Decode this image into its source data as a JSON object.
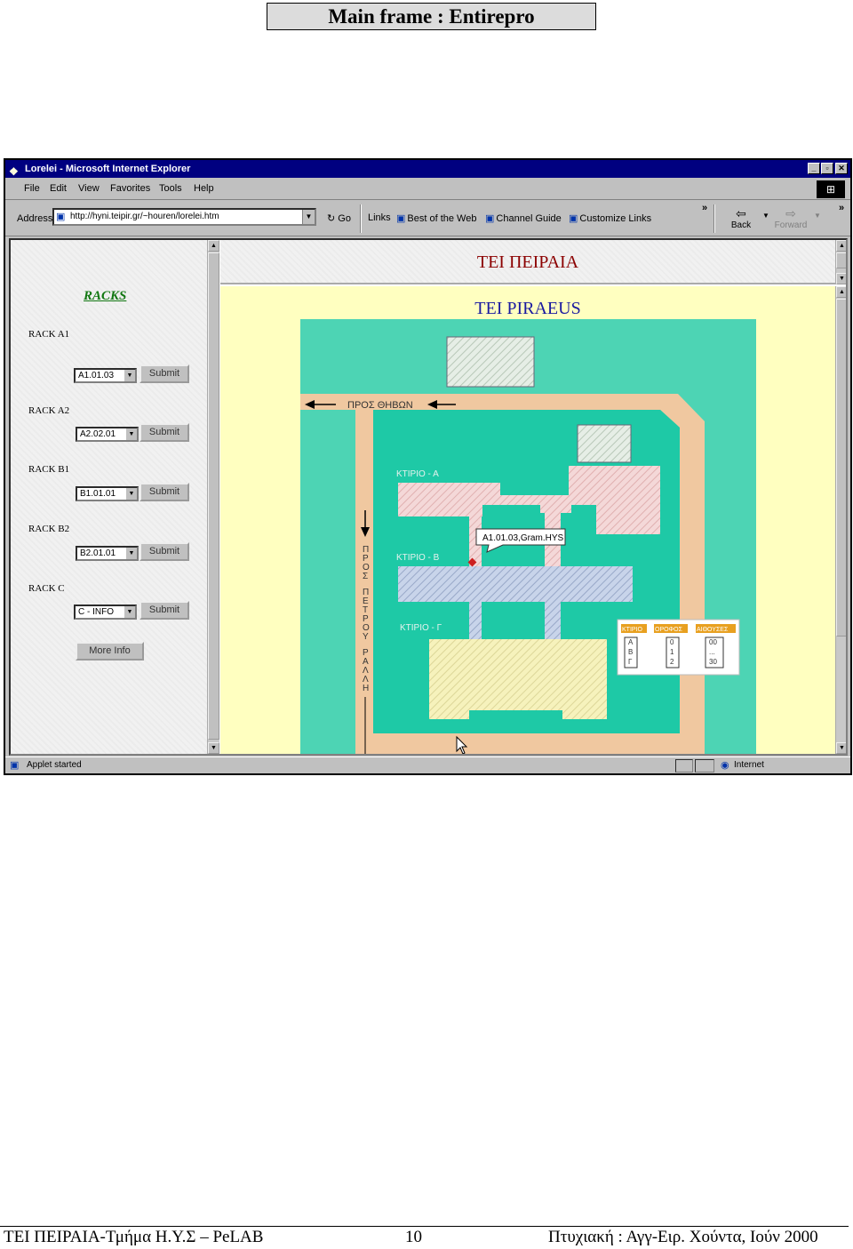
{
  "caption": "Main frame : Entirepro",
  "window": {
    "title": "Lorelei - Microsoft Internet Explorer",
    "controls": {
      "minimize": "_",
      "maximize": "▫",
      "close": "✕"
    }
  },
  "menu": [
    "File",
    "Edit",
    "View",
    "Favorites",
    "Tools",
    "Help"
  ],
  "address": {
    "label": "Address",
    "url": "http://hyni.teipir.gr/~houren/lorelei.htm",
    "go": "Go"
  },
  "links": {
    "label": "Links",
    "items": [
      "Best of the Web",
      "Channel Guide",
      "Customize Links"
    ]
  },
  "nav": {
    "back": "Back",
    "forward": "Forward"
  },
  "left_frame": {
    "title": "RACKS",
    "racks": [
      {
        "label": "RACK A1",
        "value": "A1.01.03",
        "button": "Submit"
      },
      {
        "label": "RACK A2",
        "value": "A2.02.01",
        "button": "Submit"
      },
      {
        "label": "RACK B1",
        "value": "B1.01.01",
        "button": "Submit"
      },
      {
        "label": "RACK B2",
        "value": "B2.01.01",
        "button": "Submit"
      },
      {
        "label": "RACK C",
        "value": "C - INFO",
        "button": "Submit"
      }
    ],
    "more_info": "More Info"
  },
  "top_frame": {
    "title": "TEI ΠΕΙΡΑΙΑ"
  },
  "main_frame": {
    "title": "TEI PIRAEUS",
    "map": {
      "road_top": "ΠΡΟΣ ΘΗΒΩΝ",
      "road_left": "ΠΡΟΣ ΠΕΤΡΟΥ ΡΑΛΛΗ",
      "buildings": [
        "ΚΤΙΡΙΟ - Α",
        "ΚΤΙΡΙΟ - Β",
        "ΚΤΙΡΙΟ - Γ"
      ],
      "tooltip": "A1.01.03,Gram.HYS",
      "legend": {
        "headers": [
          "ΚΤΙΡΙΟ",
          "ΟΡΟΦΟΣ",
          "ΑΙΘΟΥΣΕΣ"
        ],
        "col1": [
          "A",
          "B",
          "Γ"
        ],
        "col2": [
          "0",
          "1",
          "2"
        ],
        "col3": [
          "00",
          "...",
          "30"
        ]
      }
    }
  },
  "status": {
    "text": "Applet started",
    "zone": "Internet"
  },
  "footer": {
    "left": "TEI ΠΕΙΡΑΙΑ-Τμήμα Η.Υ.Σ – PeLAB",
    "page": "10",
    "right": "Πτυχιακή : Αγγ-Ειρ. Χούντα, Ιούν 2000"
  },
  "colors": {
    "title_bar": "#000080",
    "map_outer": "#4dd4b4",
    "map_inner": "#1ec9a6",
    "road": "#f0c8a0",
    "building_pink": "#f4d8d8",
    "building_blue": "#c8d4ea",
    "building_yellow": "#f6f2bc",
    "page_bg": "#ffffc0"
  }
}
